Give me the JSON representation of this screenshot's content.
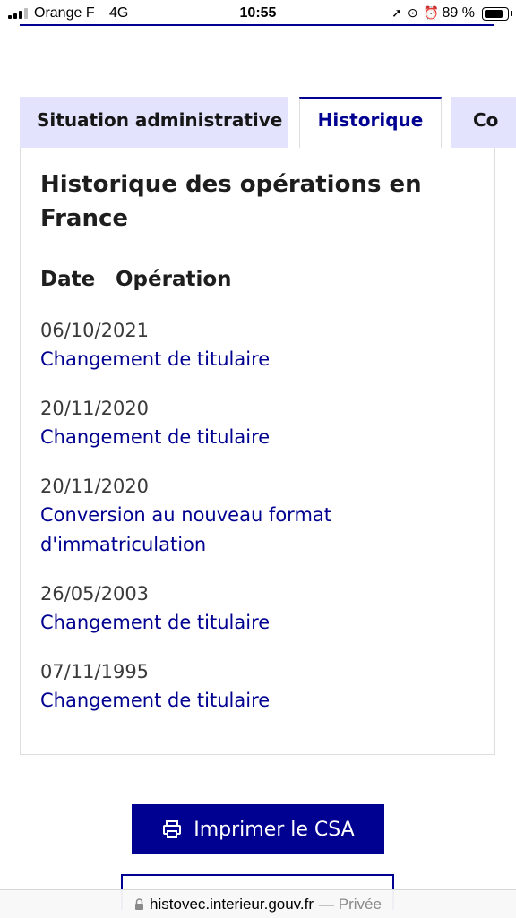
{
  "status_bar": {
    "carrier": "Orange F",
    "network": "4G",
    "time": "10:55",
    "battery_percent": "89 %",
    "battery_level": 0.89,
    "icons": [
      "location-icon",
      "orientation-lock-icon",
      "alarm-icon"
    ]
  },
  "tabs": [
    {
      "label": "Situation administrative",
      "active": false
    },
    {
      "label": "Historique",
      "active": true
    },
    {
      "label": "Co",
      "active": false
    }
  ],
  "panel": {
    "title": "Historique des opérations en France",
    "columns": {
      "date": "Date",
      "operation": "Opération"
    },
    "operations": [
      {
        "date": "06/10/2021",
        "operation": "Changement de titulaire"
      },
      {
        "date": "20/11/2020",
        "operation": "Changement de titulaire"
      },
      {
        "date": "20/11/2020",
        "operation": "Conversion au nouveau format d'immatriculation"
      },
      {
        "date": "26/05/2003",
        "operation": "Changement de titulaire"
      },
      {
        "date": "07/11/1995",
        "operation": "Changement de titulaire"
      }
    ]
  },
  "actions": {
    "print_label": "Imprimer le CSA"
  },
  "url_bar": {
    "domain": "histovec.interieur.gouv.fr",
    "suffix": "— Privée"
  },
  "colors": {
    "primary": "#000091",
    "tab_inactive_bg": "#e3e3fd"
  }
}
